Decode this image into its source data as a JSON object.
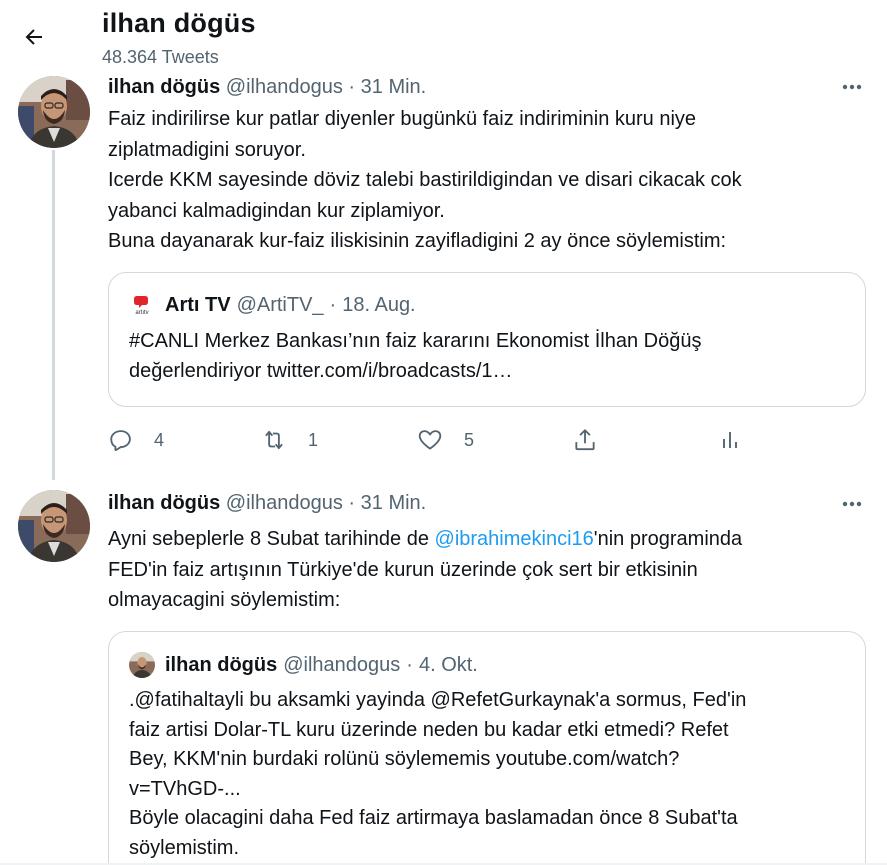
{
  "header": {
    "title": "ilhan dögüs",
    "tweet_count": "48.364 Tweets"
  },
  "tweets": [
    {
      "name": "ilhan dögüs",
      "handle": "@ilhandogus",
      "dot": "·",
      "time": "31 Min.",
      "lines": [
        "Faiz indirilirse kur patlar diyenler bugünkü faiz indiriminin kuru niye",
        "ziplatmadigini soruyor.",
        "Icerde KKM sayesinde döviz talebi bastirildigindan ve disari cikacak cok",
        "yabanci kalmadigindan kur ziplamiyor.",
        "Buna dayanarak kur-faiz iliskisinin zayifladigini 2 ay önce söylemistim:"
      ],
      "quote": {
        "name": "Artı TV",
        "handle": "@ArtiTV_",
        "dot": "·",
        "time": "18. Aug.",
        "logo_text": "artıtv",
        "lines": [
          "#CANLI Merkez Bankası’nın faiz kararını Ekonomist İlhan Döğüş",
          "değerlendiriyor twitter.com/i/broadcasts/1…"
        ]
      },
      "actions": {
        "replies": "4",
        "retweets": "1",
        "likes": "5"
      }
    },
    {
      "name": "ilhan dögüs",
      "handle": "@ilhandogus",
      "dot": "·",
      "time": "31 Min.",
      "line1_before": "Ayni sebeplerle 8 Subat tarihinde de ",
      "line1_mention": "@ibrahimekinci16",
      "line1_after": "'nin programinda",
      "lines": [
        "FED'in faiz artışının Türkiye'de kurun üzerinde çok sert bir etkisinin",
        "olmayacagini söylemistim:"
      ],
      "quote": {
        "name": "ilhan dögüs",
        "handle": "@ilhandogus",
        "dot": "·",
        "time": "4. Okt.",
        "lines": [
          ".@fatihaltayli bu aksamki yayinda @RefetGurkaynak'a sormus, Fed'in",
          "faiz artisi Dolar-TL kuru üzerinde neden bu kadar etki etmedi? Refet",
          "Bey, KKM'nin burdaki rolünü söylememis youtube.com/watch?",
          "v=TVhGD-...",
          "Böyle olacagini daha Fed faiz artirmaya baslamadan önce 8 Subat'ta",
          "söylemistim."
        ]
      }
    }
  ],
  "icons": {
    "back": "arrow-left-icon",
    "more": "more-horizontal-icon",
    "reply": "reply-icon",
    "retweet": "retweet-icon",
    "like": "heart-icon",
    "share": "share-icon",
    "analytics": "analytics-icon"
  },
  "colors": {
    "text": "#0f1419",
    "secondary": "#536471",
    "link": "#1d9bf0",
    "border": "#cfd9de",
    "logo_red": "#e0252d"
  }
}
